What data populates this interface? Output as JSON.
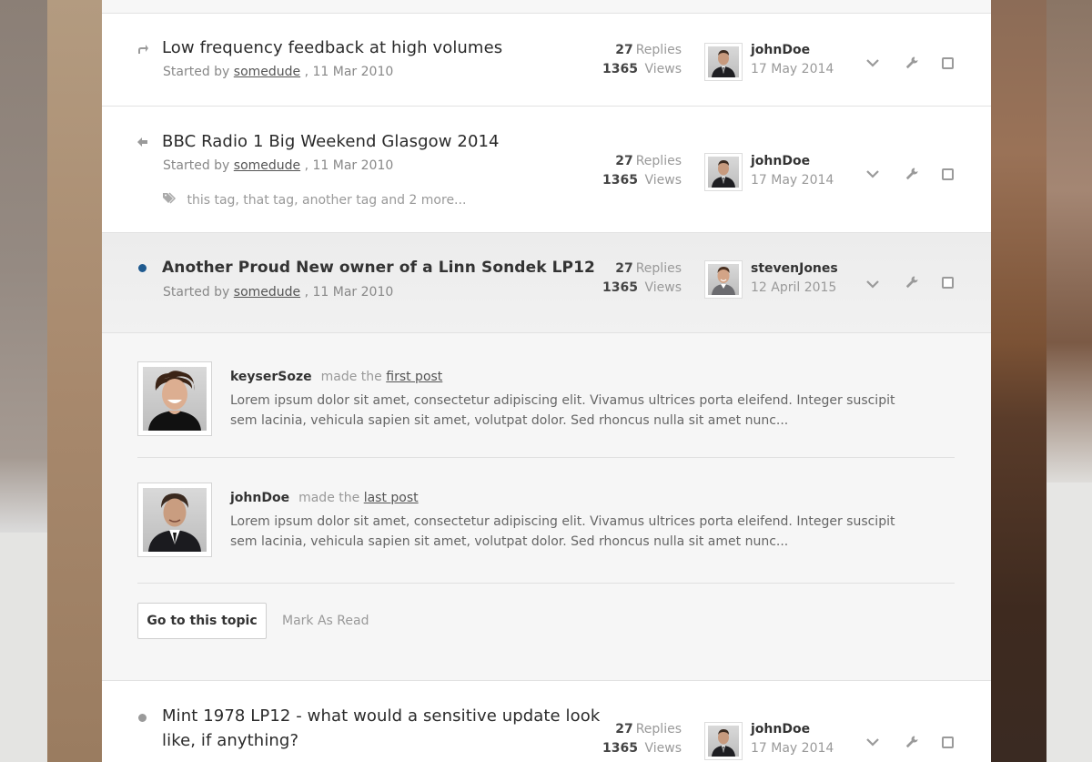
{
  "topics": [
    {
      "title": "Low frequency feedback at high volumes",
      "started_prefix": "Started by",
      "author": "somedude",
      "date": ", 11 Mar 2010",
      "replies": "27",
      "replies_label": "Replies",
      "views": "1365",
      "views_label": "Views",
      "last_user": "johnDoe",
      "last_date": "17 May 2014",
      "icon": "forward-arrow-icon"
    },
    {
      "title": "BBC Radio 1 Big Weekend Glasgow 2014",
      "started_prefix": "Started by",
      "author": "somedude",
      "date": ", 11 Mar 2010",
      "tags": "this tag, that tag, another tag and 2 more...",
      "replies": "27",
      "replies_label": "Replies",
      "views": "1365",
      "views_label": "Views",
      "last_user": "johnDoe",
      "last_date": "17 May 2014",
      "icon": "back-arrow-icon"
    },
    {
      "title": "Another Proud New owner of a Linn Sondek LP12",
      "started_prefix": "Started by",
      "author": "somedude",
      "date": ", 11 Mar 2010",
      "replies": "27",
      "replies_label": "Replies",
      "views": "1365",
      "views_label": "Views",
      "last_user": "stevenJones",
      "last_date": "12 April 2015",
      "icon": "unread-dot-icon",
      "dot_color": "#1f5a8f"
    },
    {
      "title_line1": "Mint 1978 LP12 - what would a sensitive update look",
      "title_line2": "like, if anything?",
      "replies": "27",
      "replies_label": "Replies",
      "views": "1365",
      "views_label": "Views",
      "last_user": "johnDoe",
      "last_date": "17 May 2014",
      "icon": "read-dot-icon",
      "dot_color": "#9a9a9a"
    }
  ],
  "expanded": {
    "first_post": {
      "user": "keyserSoze",
      "made_the": "made the",
      "link": "first post",
      "text": "Lorem ipsum dolor sit amet, consectetur adipiscing elit. Vivamus ultrices porta eleifend. Integer suscipit sem lacinia, vehicula sapien sit amet, volutpat dolor. Sed rhoncus nulla sit amet nunc..."
    },
    "last_post": {
      "user": "johnDoe",
      "made_the": "made the",
      "link": "last post",
      "text": "Lorem ipsum dolor sit amet, consectetur adipiscing elit. Vivamus ultrices porta eleifend. Integer suscipit sem lacinia, vehicula sapien sit amet, volutpat dolor. Sed rhoncus nulla sit amet nunc..."
    },
    "go_button": "Go to this topic",
    "mark_read": "Mark As Read"
  },
  "colors": {
    "unread_accent": "#1f5a8f",
    "panel_bg": "#ffffff",
    "expanded_bg": "#f6f6f6"
  }
}
